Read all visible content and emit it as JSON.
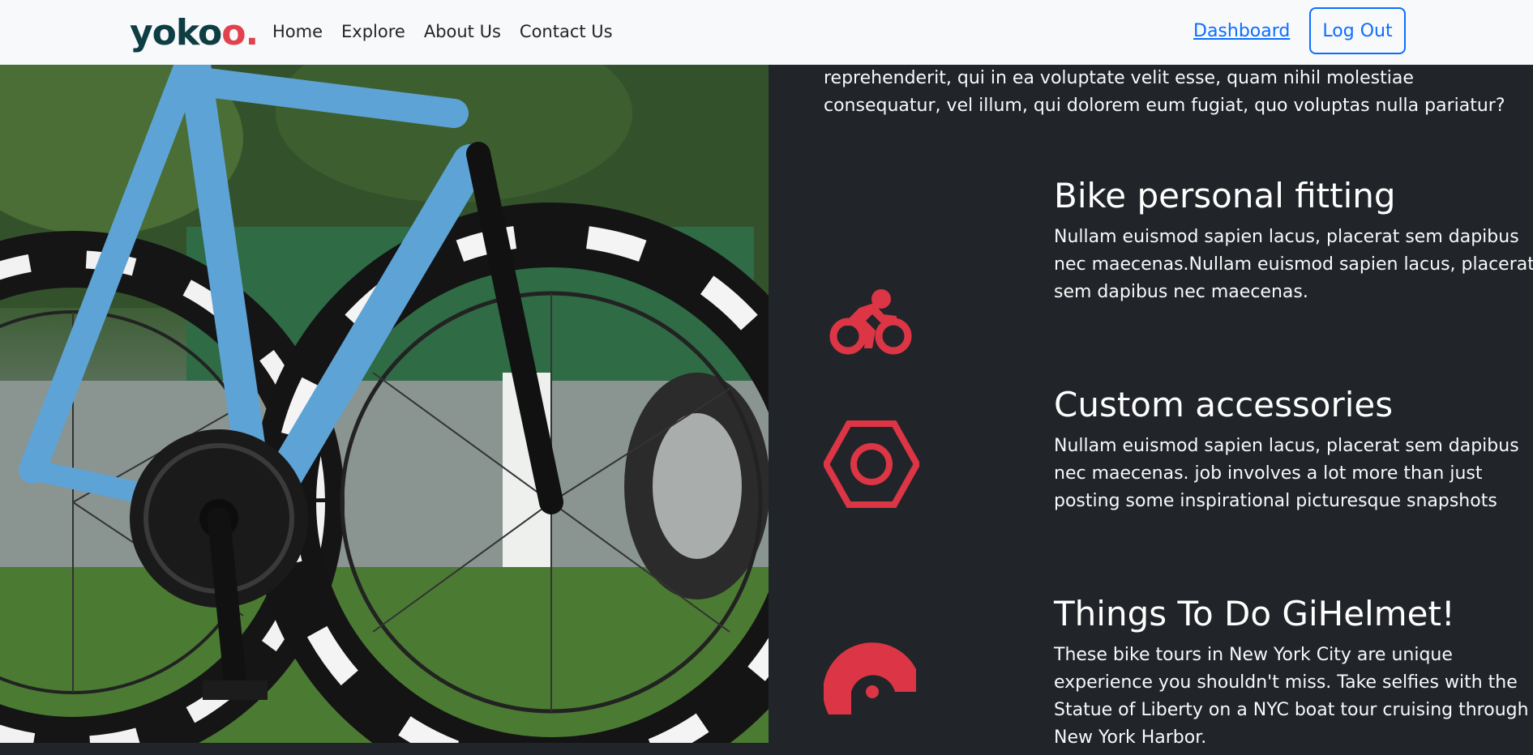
{
  "nav": {
    "brand": "yoko",
    "brand_accent": "o",
    "brand_dot": ".",
    "links": [
      "Home",
      "Explore",
      "About Us",
      "Contact Us"
    ],
    "dashboard": "Dashboard",
    "logout": "Log Out"
  },
  "intro_text": "reprehenderit, qui in ea voluptate velit esse, quam nihil molestiae consequatur, vel illum, qui dolorem eum fugiat, quo voluptas nulla pariatur?",
  "features": [
    {
      "icon": "bike-rider-icon",
      "title": "Bike personal fitting",
      "text": "Nullam euismod sapien lacus, placerat sem dapibus nec maecenas.Nullam euismod sapien lacus, placerat sem dapibus nec maecenas."
    },
    {
      "icon": "hex-nut-icon",
      "title": "Custom accessories",
      "text": "Nullam euismod sapien lacus, placerat sem dapibus nec maecenas. job involves a lot more than just posting some inspirational picturesque snapshots"
    },
    {
      "icon": "helmet-icon",
      "title": "Things To Do GiHelmet!",
      "text": "These bike tours in New York City are unique experience you shouldn't miss. Take selfies with the Statue of Liberty on a NYC boat tour cruising through New York Harbor."
    }
  ],
  "colors": {
    "accent": "#dc3545",
    "brand": "#0e3d44",
    "link": "#0d6efd",
    "dark_bg": "#212529"
  }
}
